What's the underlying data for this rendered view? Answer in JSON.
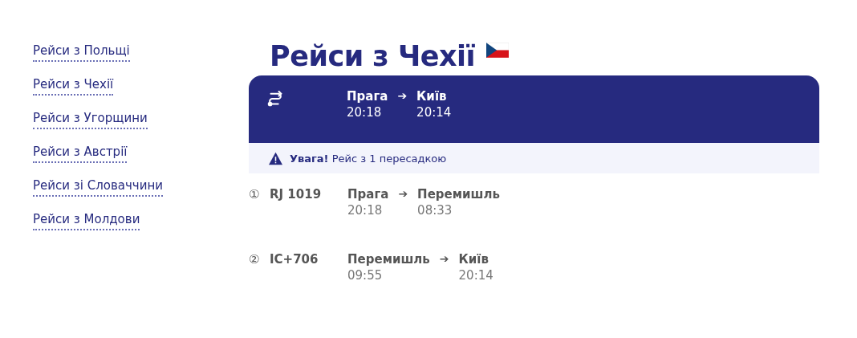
{
  "sidebar": {
    "items": [
      {
        "label": "Рейси з Польщі"
      },
      {
        "label": "Рейси з Чехії"
      },
      {
        "label": "Рейси з Угорщини"
      },
      {
        "label": "Рейси з Австрії"
      },
      {
        "label": "Рейси зі Словаччини"
      },
      {
        "label": "Рейси з Молдови"
      }
    ]
  },
  "title": "Рейси з Чехії",
  "route_card": {
    "from": "Прага",
    "arrow": "➔",
    "to": "Київ",
    "depart": "20:18",
    "arrive": "20:14"
  },
  "notice": "**Увага!** Рейс з 1 пересадкою",
  "legs": [
    {
      "number": "①",
      "train": "RJ 1019",
      "from": "Прага",
      "arrow": "➔",
      "to": "Перемишль",
      "depart": "20:18",
      "arrive": "08:33"
    },
    {
      "number": "②",
      "train": "IC+706",
      "from": "Перемишль",
      "arrow": "➔",
      "to": "Київ",
      "depart": "09:55",
      "arrive": "20:14"
    }
  ]
}
